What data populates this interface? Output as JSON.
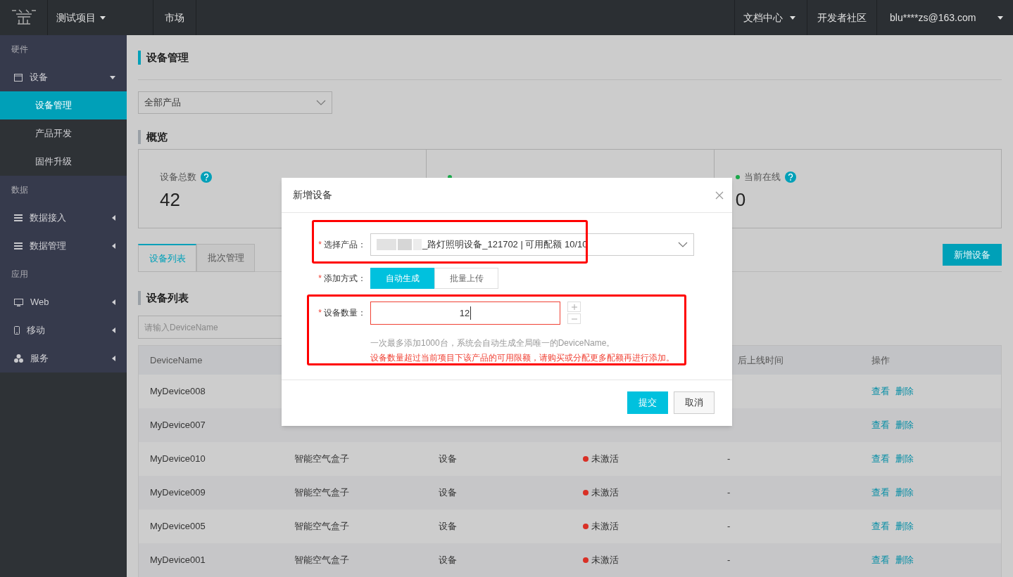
{
  "top_bar": {
    "project": "测试项目",
    "market": "市场",
    "docs": "文档中心",
    "community": "开发者社区",
    "account": "blu****zs@163.com"
  },
  "sidebar": [
    {
      "label": "硬件",
      "items": [
        {
          "label": "设备",
          "expanded": true,
          "children": [
            {
              "label": "设备管理",
              "selected": true
            },
            {
              "label": "产品开发",
              "selected": false
            },
            {
              "label": "固件升级",
              "selected": false
            }
          ]
        }
      ]
    },
    {
      "label": "数据",
      "items": [
        {
          "label": "数据接入",
          "expanded": false
        },
        {
          "label": "数据管理",
          "expanded": false
        }
      ]
    },
    {
      "label": "应用",
      "items": [
        {
          "label": "Web",
          "expanded": false
        },
        {
          "label": "移动",
          "expanded": false
        },
        {
          "label": "服务",
          "expanded": false
        }
      ]
    }
  ],
  "page_title": {
    "text": "设备管理",
    "highlighted": true
  },
  "product_filter": {
    "value": "全部产品"
  },
  "overview_title": {
    "text": "概览",
    "highlighted": false
  },
  "stats": [
    {
      "label": "设备总数",
      "value": "42",
      "online_dot": false,
      "help": true
    },
    {
      "online_dot": true
    },
    {
      "label": "当前在线",
      "value": "0",
      "online_dot": true,
      "help": true
    }
  ],
  "tabs": [
    {
      "label": "设备列表",
      "selected": true
    },
    {
      "label": "批次管理",
      "selected": false
    }
  ],
  "add_button": "新增设备",
  "list_title": {
    "text": "设备列表",
    "highlighted": false
  },
  "search": {
    "placeholder": "请输入DeviceName"
  },
  "table": {
    "columns": [
      "DeviceName",
      "后上线时间",
      "操作"
    ],
    "rows": [
      {
        "device_name": "MyDevice008",
        "actions": [
          "查看",
          "删除"
        ]
      },
      {
        "device_name": "MyDevice007",
        "actions": [
          "查看",
          "删除"
        ]
      },
      {
        "device_name": "MyDevice010",
        "product": "智能空气盒子",
        "node_type": "设备",
        "status": "未激活",
        "last_online": "-",
        "actions": [
          "查看",
          "删除"
        ]
      },
      {
        "device_name": "MyDevice009",
        "product": "智能空气盒子",
        "node_type": "设备",
        "status": "未激活",
        "last_online": "-",
        "actions": [
          "查看",
          "删除"
        ]
      },
      {
        "device_name": "MyDevice005",
        "product": "智能空气盒子",
        "node_type": "设备",
        "status": "未激活",
        "last_online": "-",
        "actions": [
          "查看",
          "删除"
        ]
      },
      {
        "device_name": "MyDevice001",
        "product": "智能空气盒子",
        "node_type": "设备",
        "status": "未激活",
        "last_online": "-",
        "actions": [
          "查看",
          "删除"
        ]
      }
    ]
  },
  "dialog": {
    "title": "新增设备",
    "required_mark": "*",
    "product_label": "选择产品：",
    "product_value": "_路灯照明设备_121702 | 可用配额 10/10",
    "method_label": "添加方式：",
    "methods": [
      {
        "label": "自动生成",
        "selected": true
      },
      {
        "label": "批量上传",
        "selected": false
      }
    ],
    "count_label": "设备数量：",
    "count_value": "12",
    "count_error": true,
    "hint": "一次最多添加1000台，系统会自动生成全局唯一的DeviceName。",
    "error": "设备数量超过当前项目下该产品的可用限额，请购买或分配更多配额再进行添加。",
    "submit": "提交",
    "cancel": "取消"
  }
}
